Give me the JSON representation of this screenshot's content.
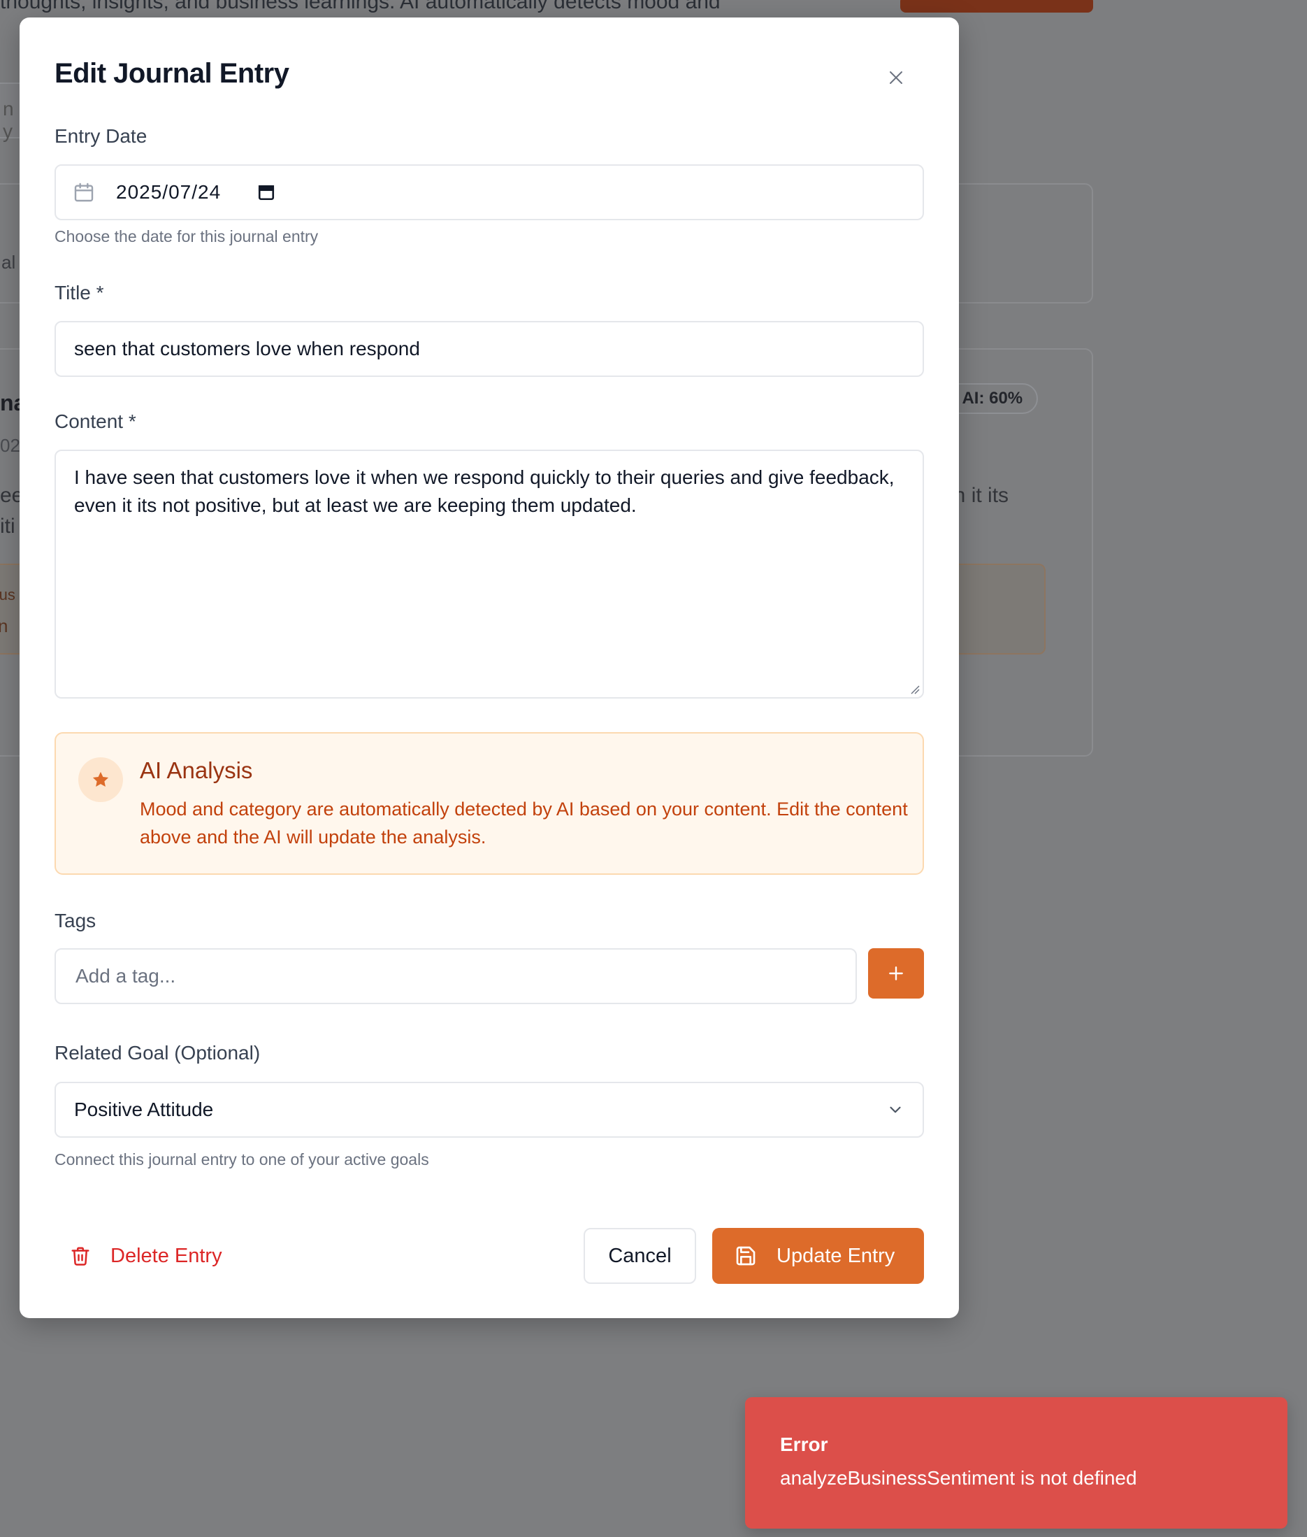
{
  "background": {
    "description_fragment": "thoughts, insights, and business learnings. AI automatically detects mood and",
    "search_fragment": "n y",
    "card1_fragment": "al",
    "card2": {
      "title_fragment": "na",
      "date_fragment": "02",
      "content_fragment_1": "ee",
      "content_fragment_2": "iti",
      "content_fragment_right": "en it its",
      "ai_badge": "AI: 60%",
      "insight_fragment_1": "Bus",
      "insight_fragment_2": "tin"
    }
  },
  "modal": {
    "title": "Edit Journal Entry",
    "close_icon": "close-icon",
    "entry_date": {
      "label": "Entry Date",
      "value": "2025/07/24",
      "help": "Choose the date for this journal entry"
    },
    "title_field": {
      "label": "Title *",
      "value": "seen that customers love when respond"
    },
    "content_field": {
      "label": "Content *",
      "value": "I have seen that customers love it when we respond quickly to their queries and give feedback, even it its not positive, but at least we are keeping them updated."
    },
    "ai_analysis": {
      "icon": "star-icon",
      "title": "AI Analysis",
      "text": "Mood and category are automatically detected by AI based on your content. Edit the content above and the AI will update the analysis."
    },
    "tags": {
      "label": "Tags",
      "placeholder": "Add a tag...",
      "add_icon": "plus-icon"
    },
    "related_goal": {
      "label": "Related Goal (Optional)",
      "selected": "Positive Attitude",
      "help": "Connect this journal entry to one of your active goals"
    },
    "actions": {
      "delete_label": "Delete Entry",
      "cancel_label": "Cancel",
      "update_label": "Update Entry"
    }
  },
  "toast": {
    "title": "Error",
    "message": "analyzeBusinessSentiment is not defined"
  },
  "colors": {
    "accent": "#dd6b2a",
    "danger": "#dc2626",
    "toast_bg": "#dc4f4a",
    "ai_box_bg": "#fff7ed"
  }
}
